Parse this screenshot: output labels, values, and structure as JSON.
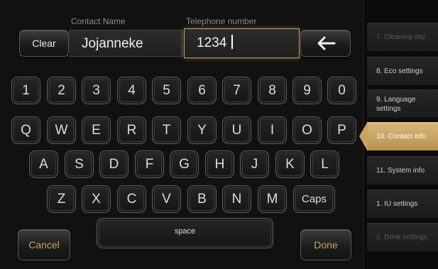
{
  "form": {
    "contact_name_label": "Contact Name",
    "telephone_label": "Telephone number",
    "contact_name_value": "Jojanneke",
    "telephone_value": "1234",
    "clear_label": "Clear",
    "backspace_icon": "arrow-left-icon"
  },
  "keyboard": {
    "row1": [
      "1",
      "2",
      "3",
      "4",
      "5",
      "6",
      "7",
      "8",
      "9",
      "0"
    ],
    "row2": [
      "Q",
      "W",
      "E",
      "R",
      "T",
      "Y",
      "U",
      "I",
      "O",
      "P"
    ],
    "row3": [
      "A",
      "S",
      "D",
      "F",
      "G",
      "H",
      "J",
      "K",
      "L"
    ],
    "row4": [
      "Z",
      "X",
      "C",
      "V",
      "B",
      "N",
      "M"
    ],
    "caps_label": "Caps",
    "space_label": "space"
  },
  "actions": {
    "cancel_label": "Cancel",
    "done_label": "Done"
  },
  "sidebar": {
    "items": [
      {
        "label": "7. Cleaning day",
        "state": "dim"
      },
      {
        "label": "8. Eco settings",
        "state": "bright"
      },
      {
        "label": "9. Language settings",
        "state": "bright"
      },
      {
        "label": "10. Contact info",
        "state": "active"
      },
      {
        "label": "11. System info",
        "state": "bright"
      },
      {
        "label": "1. IU settings",
        "state": "bright"
      },
      {
        "label": "2. Drink settings",
        "state": "dim"
      }
    ]
  },
  "colors": {
    "accent_gold": "#c9a264",
    "active_item": "#d9b77c",
    "background": "#111111"
  }
}
